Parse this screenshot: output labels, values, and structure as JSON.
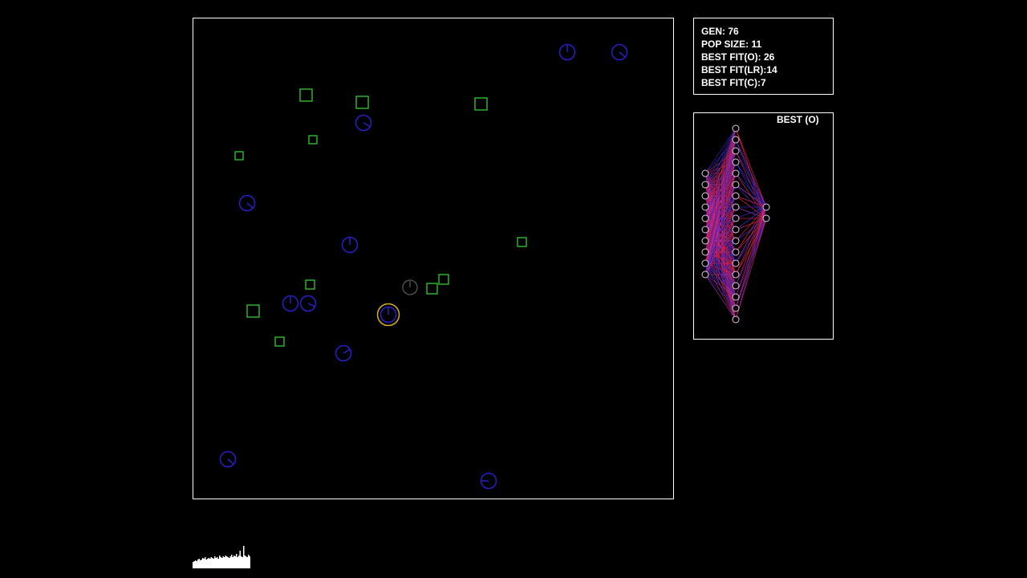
{
  "stats": {
    "gen": "GEN: 76",
    "pop_size": "POP SIZE: 11",
    "best_fit_o": "BEST FIT(O): 26",
    "best_fit_lr": "BEST FIT(LR):14",
    "best_fit_c": "BEST FIT(C):7"
  },
  "network_panel": {
    "label": "BEST (O)",
    "input_count": 10,
    "hidden_count": 18,
    "output_count": 2
  },
  "colors": {
    "agent": "#2a1fc8",
    "food": "#33cc33",
    "selected": "#d4b020",
    "dead_agent": "#555555",
    "border": "#ffffff",
    "weight_pos": "#e0204a",
    "weight_neg": "#3a2ad0"
  },
  "icons": {
    "agent": "circle-with-heading-line-icon",
    "food": "square-outline-icon"
  }
}
